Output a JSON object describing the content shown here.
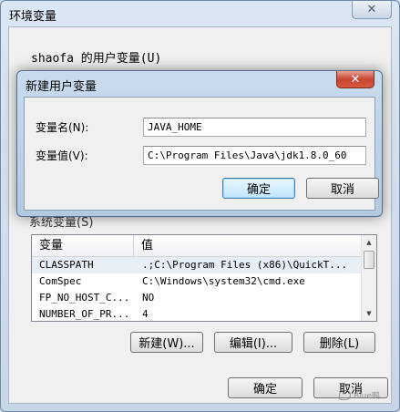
{
  "outer": {
    "title": "环境变量",
    "close_glyph": "✕",
    "user_vars_label": "shaofa 的用户变量(U)",
    "system_vars_label": "系统变量(S)",
    "system_table": {
      "headers": [
        "变量",
        "值"
      ],
      "rows": [
        {
          "name": "CLASSPATH",
          "value": ".;C:\\Program Files (x86)\\QuickT..."
        },
        {
          "name": "ComSpec",
          "value": "C:\\Windows\\system32\\cmd.exe"
        },
        {
          "name": "FP_NO_HOST_C...",
          "value": "NO"
        },
        {
          "name": "NUMBER_OF_PR...",
          "value": "4"
        }
      ]
    },
    "buttons": {
      "new": "新建(W)...",
      "edit": "编辑(I)...",
      "delete": "删除(L)",
      "ok": "确定",
      "cancel": "取消"
    }
  },
  "dialog": {
    "title": "新建用户变量",
    "close_glyph": "✕",
    "name_label": "变量名(N):",
    "name_value": "JAVA_HOME",
    "value_label": "变量值(V):",
    "value_value": "C:\\Program Files\\Java\\jdk1.8.0_60",
    "ok": "确定",
    "cancel": "取消"
  },
  "watermark": {
    "text": "Blue鸭"
  }
}
